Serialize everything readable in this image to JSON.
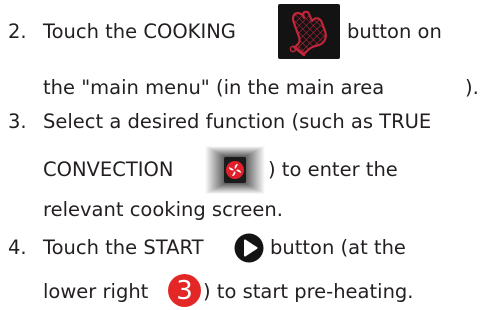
{
  "steps": [
    {
      "number": "2.",
      "line1_before": "Touch the COOKING",
      "line1_after": "button on",
      "line2": "the \"main menu\" (in the main area",
      "line2_end": ").",
      "icon": "oven-mitt-icon"
    },
    {
      "number": "3.",
      "line1": "Select a desired function (such as TRUE",
      "line2_before": "CONVECTION",
      "line2_after": ") to enter the",
      "line3": "relevant cooking screen.",
      "icon": "fan-icon"
    },
    {
      "number": "4.",
      "line1_before": "Touch the START",
      "line1_after": "button (at the",
      "line2_before": "lower right",
      "line2_after": ") to start pre-heating.",
      "icon": "play-icon",
      "badge": "3"
    }
  ],
  "colors": {
    "text": "#231f20",
    "icon_bg": "#131313",
    "mitt_red": "#c0253a",
    "badge_red": "#e32726"
  }
}
